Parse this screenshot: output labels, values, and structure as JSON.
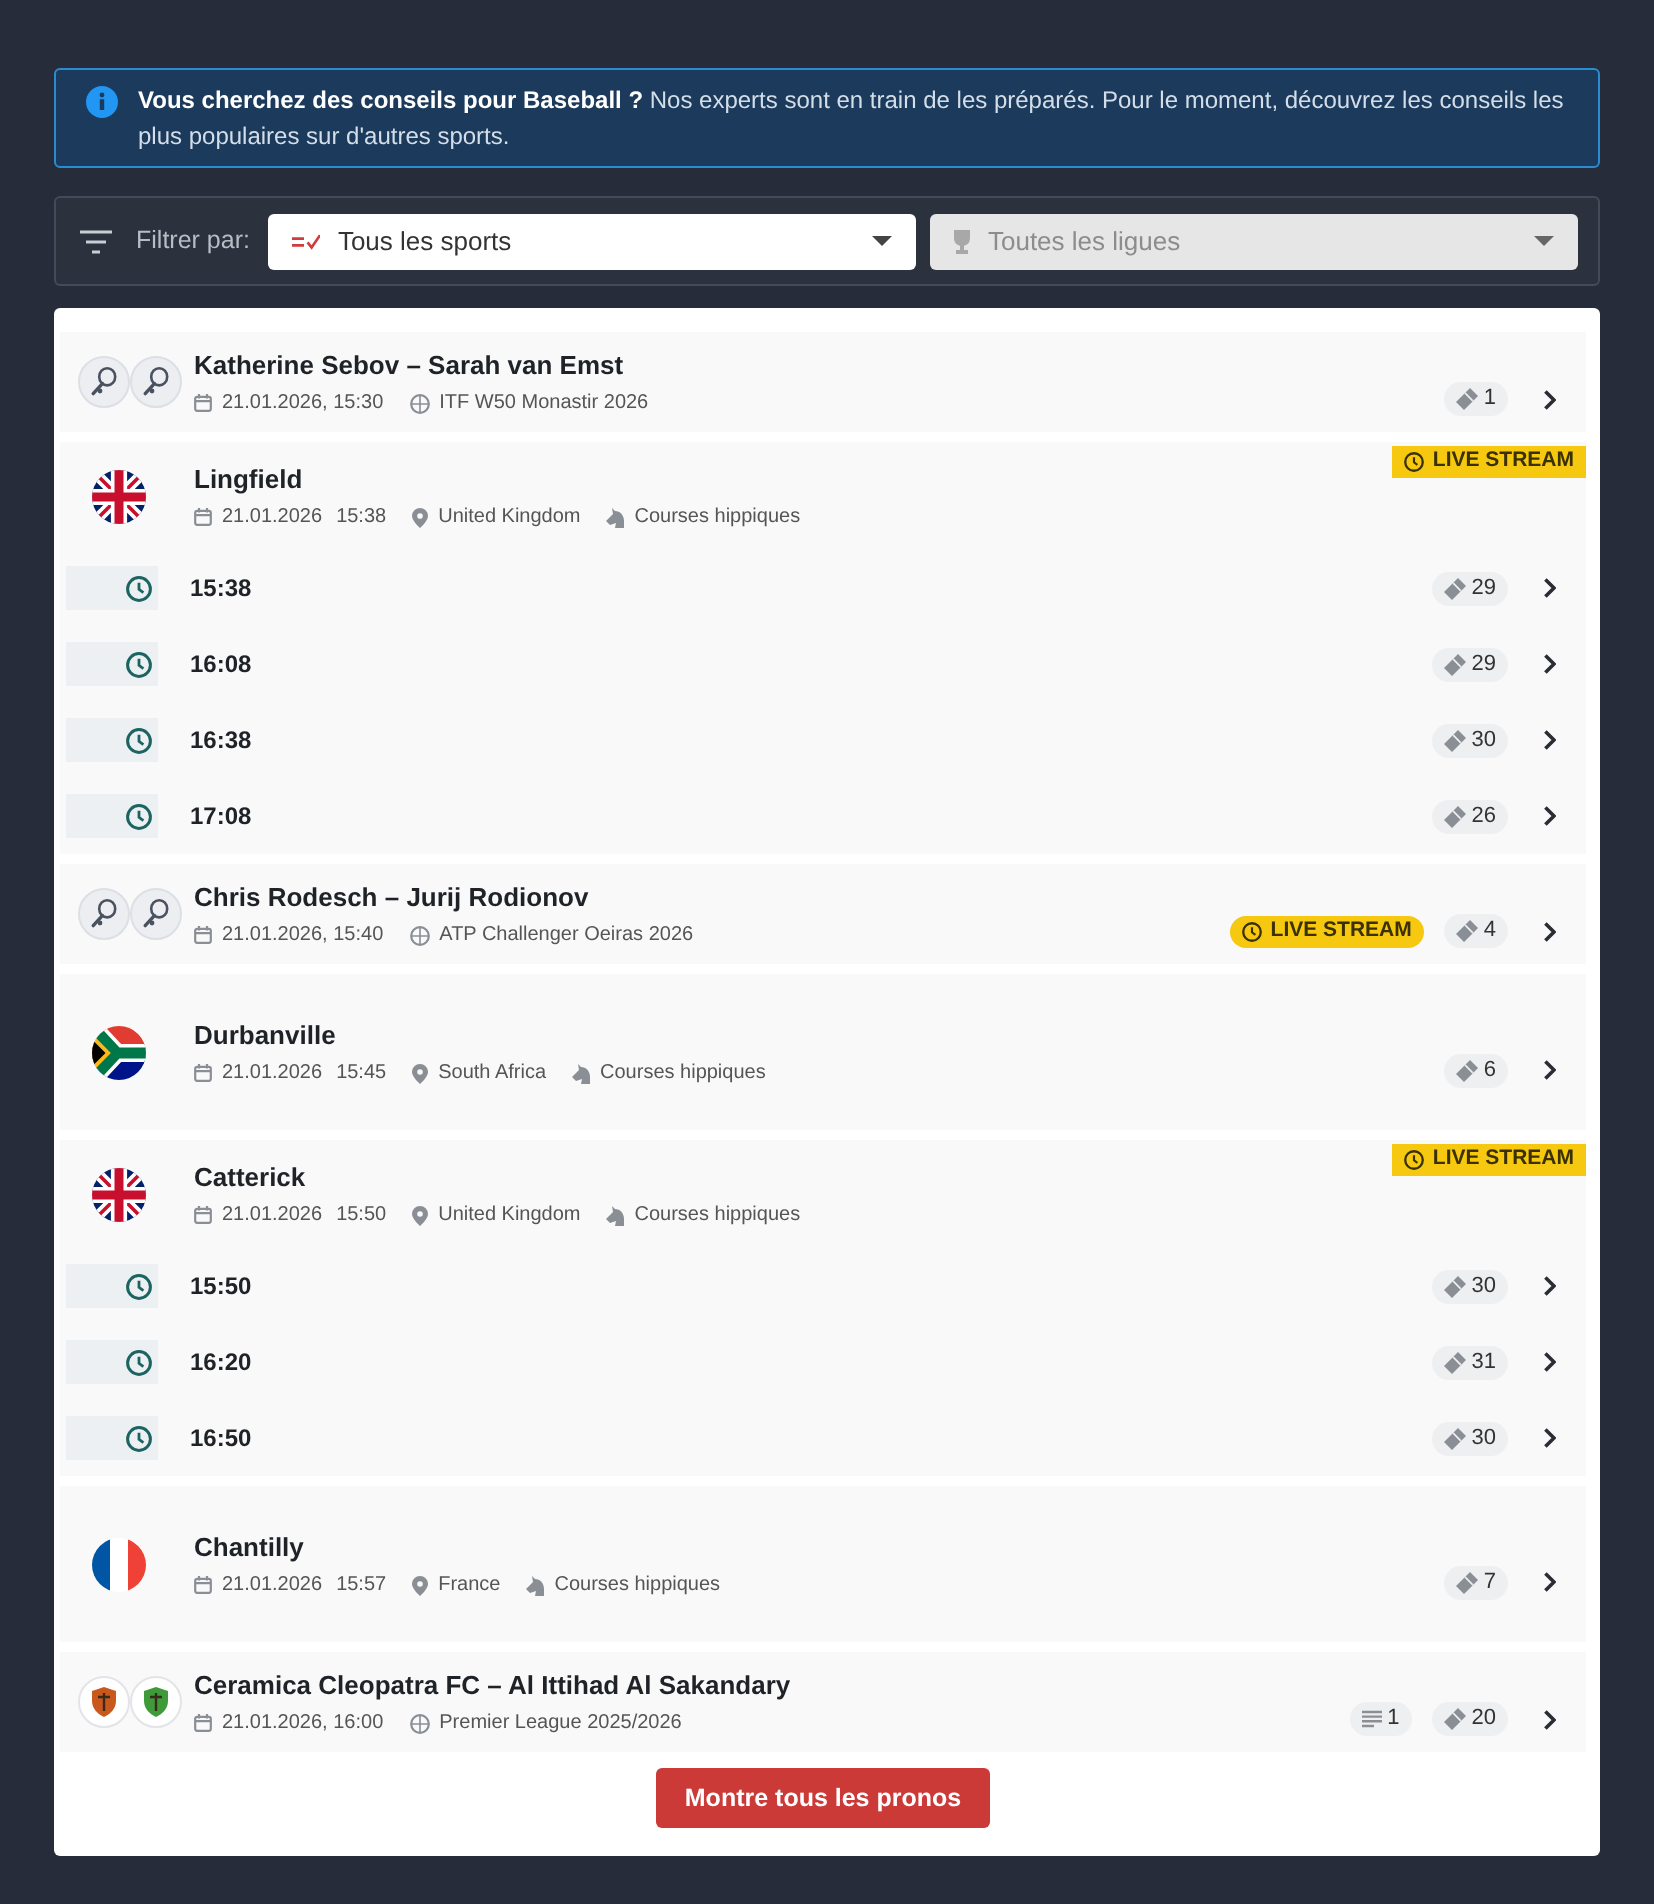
{
  "alert": {
    "text": "**Vous cherchez des conseils pour Baseball ?** Nos experts sont en train de les préparés. Pour le moment, découvrez les conseils les plus populaires sur d'autres sports."
  },
  "filter": {
    "label": "Filtrer par:",
    "selects": [
      {
        "kind": "sport",
        "value": "Tous les sports",
        "disabled": false
      },
      {
        "kind": "league",
        "value": "Toutes les ligues",
        "disabled": true
      }
    ]
  },
  "events": [
    {
      "kind": "match",
      "avatars": [
        {
          "kind": "racket"
        },
        {
          "kind": "racket"
        }
      ],
      "title": "Katherine Sebov – Sarah van Emst",
      "datetime": "21.01.2026, 15:30",
      "league": "ITF W50 Monastir 2026",
      "tips": "1"
    },
    {
      "kind": "meeting",
      "flag": {
        "kind": "uk"
      },
      "title": "Lingfield",
      "date": "21.01.2026",
      "time": "15:38",
      "country": "United Kingdom",
      "sport": "Courses hippiques",
      "live_stream": "LIVE STREAM",
      "races": [
        {
          "time": "15:38",
          "tips": "29"
        },
        {
          "time": "16:08",
          "tips": "29"
        },
        {
          "time": "16:38",
          "tips": "30"
        },
        {
          "time": "17:08",
          "tips": "26"
        }
      ]
    },
    {
      "kind": "match",
      "avatars": [
        {
          "kind": "racket"
        },
        {
          "kind": "racket"
        }
      ],
      "title": "Chris Rodesch – Jurij Rodionov",
      "datetime": "21.01.2026, 15:40",
      "league": "ATP Challenger Oeiras 2026",
      "live_stream": "LIVE STREAM",
      "tips": "4"
    },
    {
      "kind": "meeting",
      "flag": {
        "kind": "za"
      },
      "title": "Durbanville",
      "date": "21.01.2026",
      "time": "15:45",
      "country": "South Africa",
      "sport": "Courses hippiques",
      "tips": "6"
    },
    {
      "kind": "meeting",
      "flag": {
        "kind": "uk"
      },
      "title": "Catterick",
      "date": "21.01.2026",
      "time": "15:50",
      "country": "United Kingdom",
      "sport": "Courses hippiques",
      "live_stream": "LIVE STREAM",
      "races": [
        {
          "time": "15:50",
          "tips": "30"
        },
        {
          "time": "16:20",
          "tips": "31"
        },
        {
          "time": "16:50",
          "tips": "30"
        }
      ]
    },
    {
      "kind": "meeting",
      "flag": {
        "kind": "fr"
      },
      "title": "Chantilly",
      "date": "21.01.2026",
      "time": "15:57",
      "country": "France",
      "sport": "Courses hippiques",
      "tips": "7"
    },
    {
      "kind": "match",
      "avatars": [
        {
          "kind": "crest",
          "color": "#c9581f"
        },
        {
          "kind": "crest",
          "color": "#3f9a3a"
        }
      ],
      "title": "Ceramica Cleopatra FC – Al Ittihad Al Sakandary",
      "datetime": "21.01.2026, 16:00",
      "league": "Premier League 2025/2026",
      "articles": "1",
      "tips": "20"
    }
  ],
  "show_all_button": "Montre tous les pronos"
}
